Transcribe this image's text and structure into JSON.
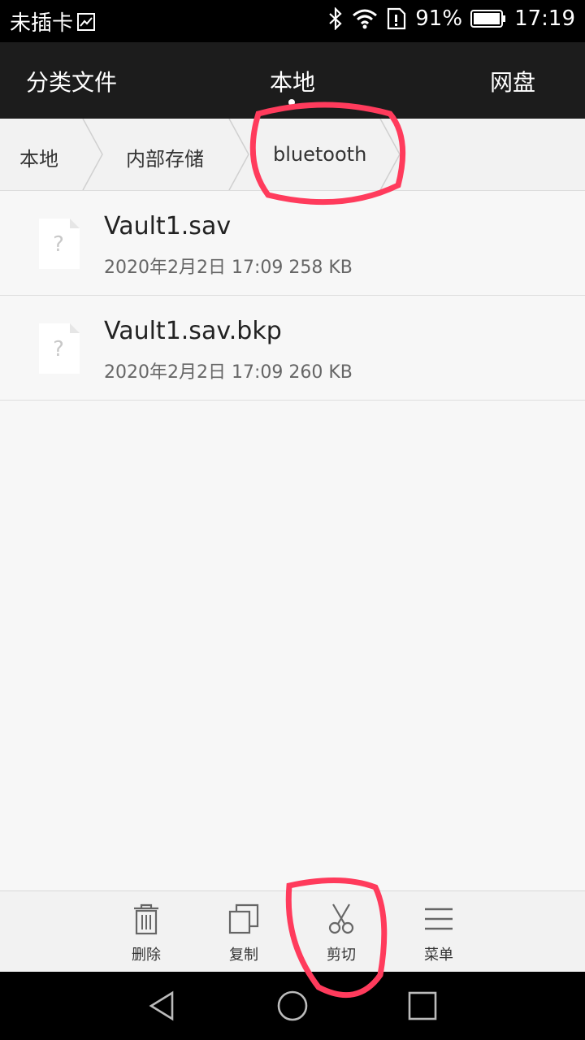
{
  "status_bar": {
    "carrier": "未插卡",
    "battery_percent": "91%",
    "time": "17:19"
  },
  "tabs": [
    {
      "label": "分类文件"
    },
    {
      "label": "本地"
    },
    {
      "label": "网盘"
    }
  ],
  "breadcrumb": [
    {
      "label": "本地"
    },
    {
      "label": "内部存储"
    },
    {
      "label": "bluetooth"
    }
  ],
  "files": [
    {
      "name": "Vault1.sav",
      "meta": "2020年2月2日 17:09 258 KB",
      "icon": "unknown-file-icon"
    },
    {
      "name": "Vault1.sav.bkp",
      "meta": "2020年2月2日 17:09 260 KB",
      "icon": "unknown-file-icon"
    }
  ],
  "actions": [
    {
      "label": "删除",
      "icon": "trash-icon"
    },
    {
      "label": "复制",
      "icon": "copy-icon"
    },
    {
      "label": "剪切",
      "icon": "scissors-icon"
    },
    {
      "label": "菜单",
      "icon": "menu-icon"
    }
  ],
  "colors": {
    "annotation": "#ff3b5c",
    "header_bg": "#1c1c1c",
    "status_bg": "#000000"
  }
}
